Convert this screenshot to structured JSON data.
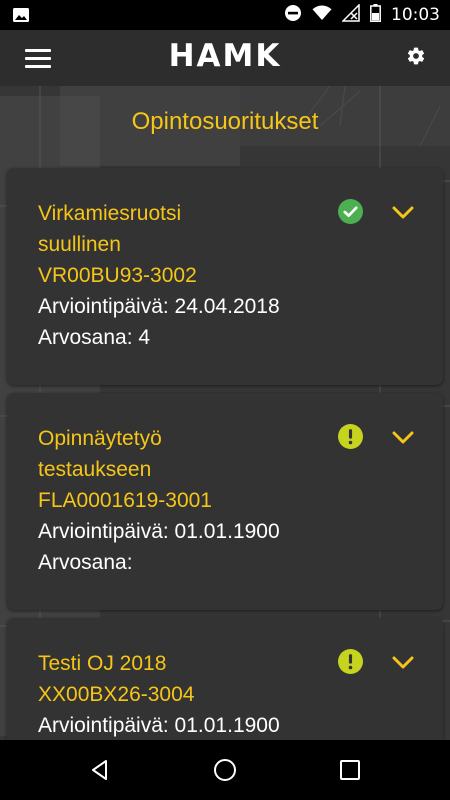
{
  "status_bar": {
    "time": "10:03",
    "icons": [
      "image-notification-icon",
      "do-not-disturb-icon",
      "wifi-icon",
      "no-signal-icon",
      "battery-icon"
    ]
  },
  "app_bar": {
    "brand": "HAMK",
    "menu_icon": "hamburger-menu-icon",
    "settings_icon": "gear-icon"
  },
  "page": {
    "title": "Opintosuoritukset"
  },
  "courses": [
    {
      "name_line1": "Virkamiesruotsi",
      "name_line2": "suullinen",
      "code": "VR00BU93-3002",
      "date_text": "Arviointipäivä: 24.04.2018",
      "grade_text": "Arvosana: 4",
      "status": "completed",
      "status_icon": "check-circle-icon",
      "status_color": "#4caf50"
    },
    {
      "name_line1": "Opinnäytetyö",
      "name_line2": "testaukseen",
      "code": "FLA0001619-3001",
      "date_text": "Arviointipäivä: 01.01.1900",
      "grade_text": "Arvosana:",
      "status": "pending",
      "status_icon": "exclamation-circle-icon",
      "status_color": "#c6d31f"
    },
    {
      "name_line1": "Testi OJ 2018",
      "code": "XX00BX26-3004",
      "date_text": "Arviointipäivä: 01.01.1900",
      "status": "pending",
      "status_icon": "exclamation-circle-icon",
      "status_color": "#c6d31f"
    }
  ],
  "colors": {
    "accent": "#f5c518",
    "card": "#333333",
    "app_bar": "#2d2d2d"
  },
  "nav_bar": {
    "icons": [
      "back-icon",
      "home-icon",
      "recents-icon"
    ]
  }
}
